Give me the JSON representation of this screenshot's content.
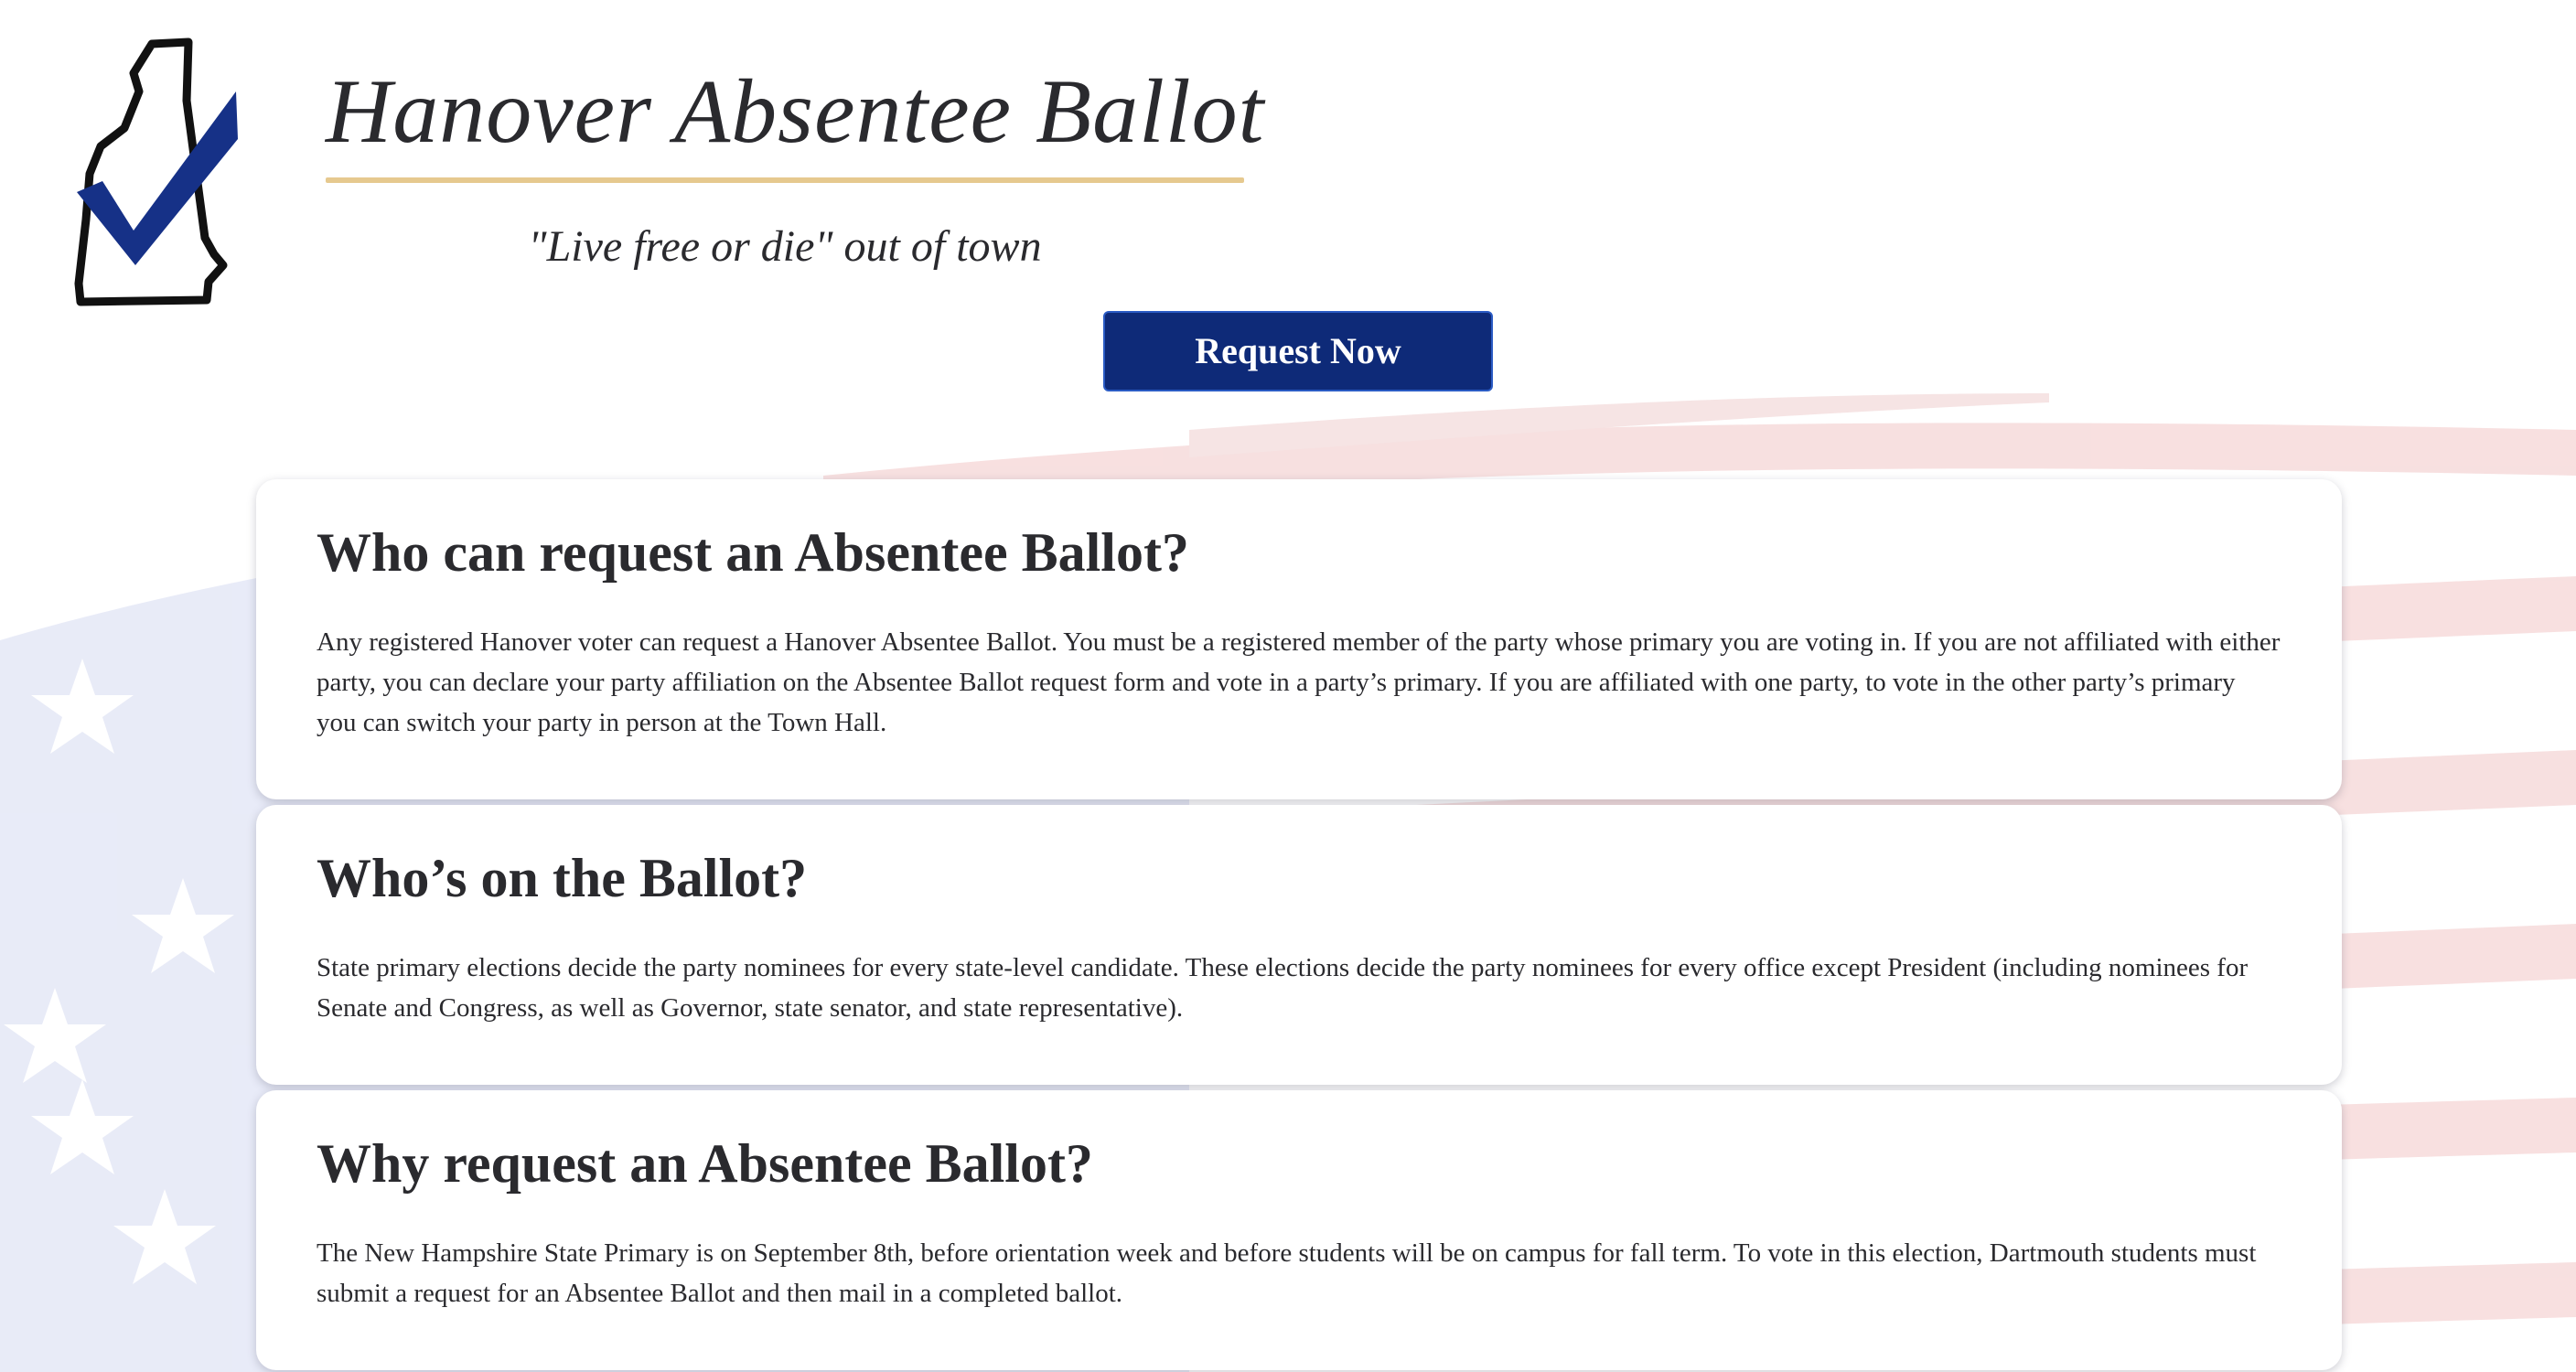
{
  "header": {
    "title": "Hanover Absentee Ballot",
    "tagline": "\"Live free or die\" out of town",
    "request_button_label": "Request Now",
    "logo_icon": "nh-state-checkmark-icon"
  },
  "colors": {
    "brand_navy": "#0e2a78",
    "title_rule_gold": "#e6c98f",
    "text": "#2a2a2e",
    "flag_blue_wash": "#e4e7f6",
    "flag_red_wash": "#f6dada"
  },
  "sections": [
    {
      "heading": "Who can request an Absentee Ballot?",
      "body": "Any registered Hanover voter can request a Hanover Absentee Ballot. You must be a registered member of the party whose primary you are voting in. If you are not affiliated with either party, you can declare your party affiliation on the Absentee Ballot request form and vote in a party’s primary. If you are affiliated with one party, to vote in the other party’s primary you can switch your party in person at the Town Hall."
    },
    {
      "heading": "Who’s on the Ballot?",
      "body": "State primary elections decide the party nominees for every state-level candidate. These elections decide the party nominees for every office except President (including nominees for Senate and Congress, as well as Governor, state senator, and state representative)."
    },
    {
      "heading": "Why request an Absentee Ballot?",
      "body": "The New Hampshire State Primary is on September 8th, before orientation week and before students will be on campus for fall term. To vote in this election, Dartmouth students must submit a request for an Absentee Ballot and then mail in a completed ballot."
    }
  ]
}
